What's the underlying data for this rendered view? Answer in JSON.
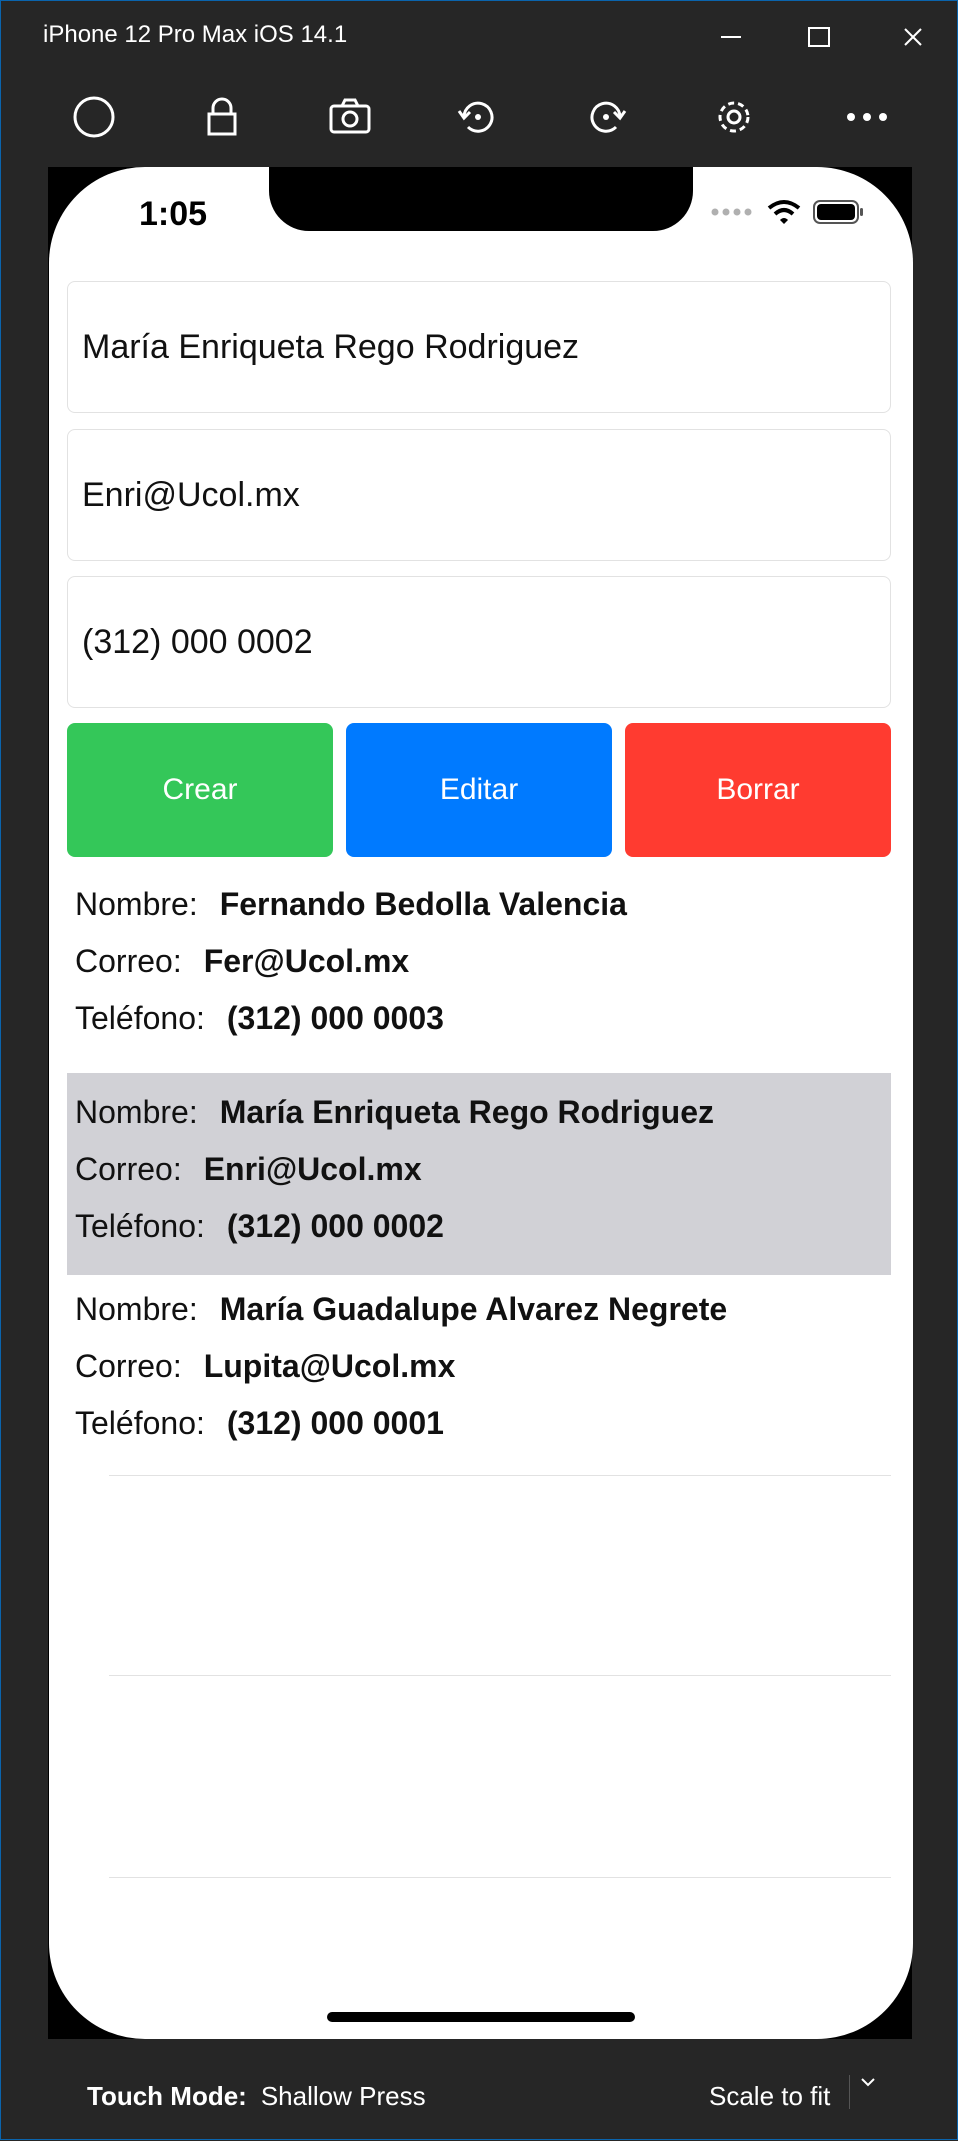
{
  "window": {
    "title": "iPhone 12 Pro Max iOS 14.1",
    "toolbar_icons": [
      "home-icon",
      "lock-icon",
      "screenshot-icon",
      "rotate-left-icon",
      "rotate-right-icon",
      "settings-icon",
      "more-icon"
    ]
  },
  "status_bar": {
    "time": "1:05"
  },
  "form": {
    "name_value": "María Enriqueta Rego Rodriguez",
    "email_value": "Enri@Ucol.mx",
    "phone_value": "(312) 000 0002"
  },
  "buttons": {
    "create": "Crear",
    "edit": "Editar",
    "delete": "Borrar",
    "colors": {
      "create": "#34c759",
      "edit": "#007aff",
      "delete": "#ff3b30"
    }
  },
  "labels": {
    "name": "Nombre:",
    "email": "Correo:",
    "phone": "Teléfono:"
  },
  "records": [
    {
      "name": "Fernando Bedolla Valencia",
      "email": "Fer@Ucol.mx",
      "phone": "(312) 000 0003",
      "selected": false
    },
    {
      "name": "María Enriqueta Rego Rodriguez",
      "email": "Enri@Ucol.mx",
      "phone": "(312) 000 0002",
      "selected": true
    },
    {
      "name": "María Guadalupe Alvarez Negrete",
      "email": "Lupita@Ucol.mx",
      "phone": "(312) 000 0001",
      "selected": false
    }
  ],
  "footer": {
    "touch_mode_label": "Touch Mode:",
    "touch_mode_value": "Shallow Press",
    "scale": "Scale to fit"
  }
}
